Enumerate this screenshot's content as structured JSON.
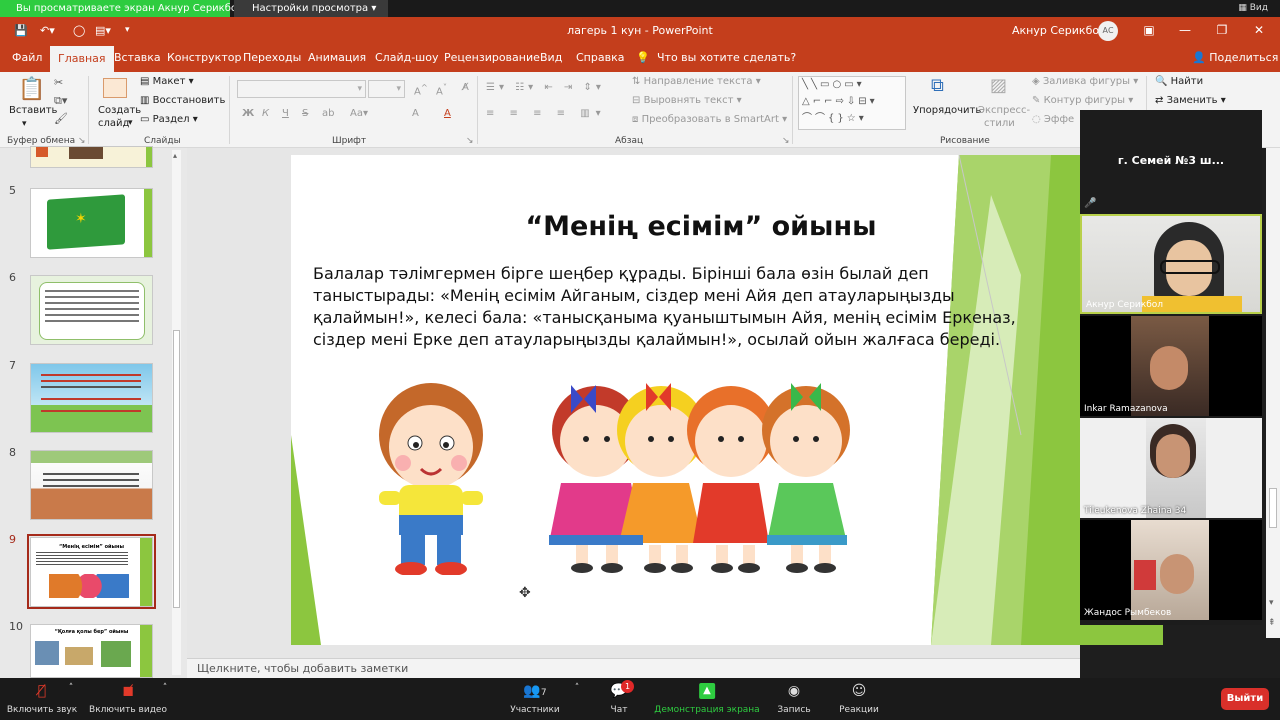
{
  "zoom": {
    "sharing_banner": "Вы просматриваете экран Акнур Серикбол",
    "view_options": "Настройки просмотра",
    "view_label": "Вид",
    "panel_title": "г. Семей №3 ш...",
    "participants": [
      {
        "name": "Акнур Серикбол"
      },
      {
        "name": "Inkar Ramazanova"
      },
      {
        "name": "Tileukenova Zhaina 34"
      },
      {
        "name": "Жандос Рымбеков"
      }
    ],
    "toolbar": {
      "mute": "Включить звук",
      "video": "Включить видео",
      "participants": "Участники",
      "participants_count": "7",
      "chat": "Чат",
      "chat_badge": "1",
      "share": "Демонстрация экрана",
      "record": "Запись",
      "reactions": "Реакции",
      "leave": "Выйти"
    }
  },
  "ppt": {
    "title": "лагерь 1 кун  -  PowerPoint",
    "user": "Акнур Серикбол",
    "user_initials": "АС",
    "tabs": [
      "Файл",
      "Главная",
      "Вставка",
      "Конструктор",
      "Переходы",
      "Анимация",
      "Слайд-шоу",
      "Рецензирование",
      "Вид",
      "Справка"
    ],
    "tell_me": "Что вы хотите сделать?",
    "share": "Поделиться",
    "ribbon": {
      "paste": "Вставить",
      "clipboard": "Буфер обмена",
      "new_slide_1": "Создать",
      "new_slide_2": "слайд",
      "layout": "Макет",
      "reset": "Восстановить",
      "section": "Раздел",
      "slides": "Слайды",
      "font": "Шрифт",
      "font_buttons": [
        "Ж",
        "К",
        "Ч",
        "S",
        "A",
        "A"
      ],
      "paragraph": "Абзац",
      "text_direction": "Направление текста",
      "align_text": "Выровнять текст",
      "smartart": "Преобразовать в SmartArt",
      "arrange": "Упорядочить",
      "quick_styles_1": "Экспресс-",
      "quick_styles_2": "стили",
      "shape_fill": "Заливка фигуры",
      "shape_outline": "Контур фигуры",
      "shape_effects": "Эффе",
      "drawing": "Рисование",
      "find": "Найти",
      "replace": "Заменить"
    },
    "thumbnails": [
      {
        "num": "5"
      },
      {
        "num": "6"
      },
      {
        "num": "7"
      },
      {
        "num": "8"
      },
      {
        "num": "9",
        "title": "“Менің есімім” ойыны"
      },
      {
        "num": "10",
        "title": "“Қолға қолы бер” ойыны"
      }
    ],
    "slide": {
      "title": "“Менің есімім” ойыны",
      "body": "Балалар тәлімгермен бірге шеңбер құрады. Бірінші бала өзін былай деп таныстырады: «Менің есімім Айганым, сіздер мені Айя деп атауларыңызды қалаймын!», келесі бала: «танысқаныма қуаныштымын Айя, менің есімім Еркеназ, сіздер мені  Ерке деп атауларыңызды қалаймын!», осылай ойын жалғаса береді."
    },
    "notes_placeholder": "Щелкните, чтобы добавить заметки"
  }
}
